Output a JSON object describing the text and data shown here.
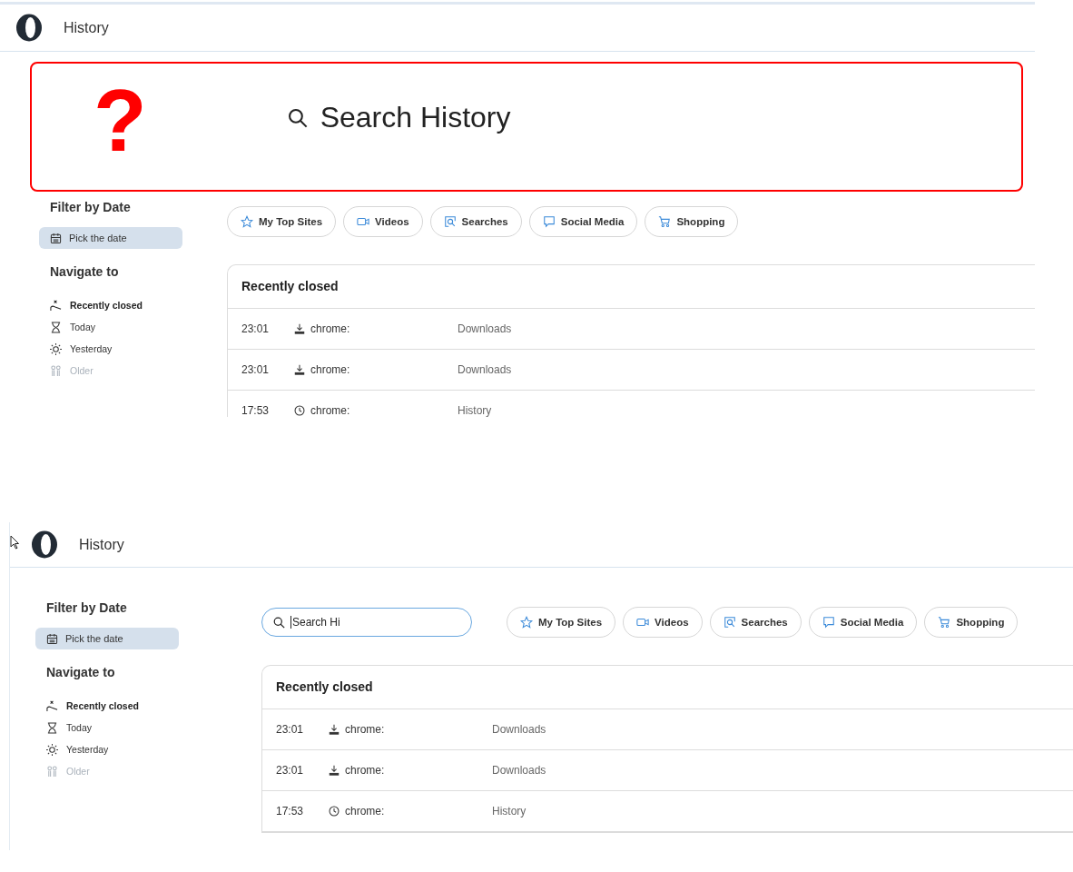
{
  "panels": [
    {
      "title": "History",
      "pointer_shown": false,
      "search": {
        "kind": "highlight",
        "mark": "?",
        "placeholder": "Search History"
      },
      "filter_heading": "Filter by Date",
      "date_button": "Pick the date",
      "nav_heading": "Navigate to",
      "nav_items": [
        {
          "label": "Recently closed",
          "selected": true,
          "disabled": false
        },
        {
          "label": "Today",
          "selected": false,
          "disabled": false
        },
        {
          "label": "Yesterday",
          "selected": false,
          "disabled": false
        },
        {
          "label": "Older",
          "selected": false,
          "disabled": true
        }
      ],
      "chips": [
        "My Top Sites",
        "Videos",
        "Searches",
        "Social Media",
        "Shopping"
      ],
      "table": {
        "title": "Recently closed",
        "rows": [
          {
            "time": "23:01",
            "kind": "download",
            "site": "chrome:",
            "title": "Downloads"
          },
          {
            "time": "23:01",
            "kind": "download",
            "site": "chrome:",
            "title": "Downloads"
          },
          {
            "time": "17:53",
            "kind": "clock",
            "site": "chrome:",
            "title": "History"
          }
        ]
      }
    },
    {
      "title": "History",
      "pointer_shown": true,
      "search": {
        "kind": "field",
        "value": "Search Hi"
      },
      "filter_heading": "Filter by Date",
      "date_button": "Pick the date",
      "nav_heading": "Navigate to",
      "nav_items": [
        {
          "label": "Recently closed",
          "selected": true,
          "disabled": false
        },
        {
          "label": "Today",
          "selected": false,
          "disabled": false
        },
        {
          "label": "Yesterday",
          "selected": false,
          "disabled": false
        },
        {
          "label": "Older",
          "selected": false,
          "disabled": true
        }
      ],
      "chips": [
        "My Top Sites",
        "Videos",
        "Searches",
        "Social Media",
        "Shopping"
      ],
      "table": {
        "title": "Recently closed",
        "rows": [
          {
            "time": "23:01",
            "kind": "download",
            "site": "chrome:",
            "title": "Downloads"
          },
          {
            "time": "23:01",
            "kind": "download",
            "site": "chrome:",
            "title": "Downloads"
          },
          {
            "time": "17:53",
            "kind": "clock",
            "site": "chrome:",
            "title": "History"
          }
        ]
      }
    }
  ]
}
